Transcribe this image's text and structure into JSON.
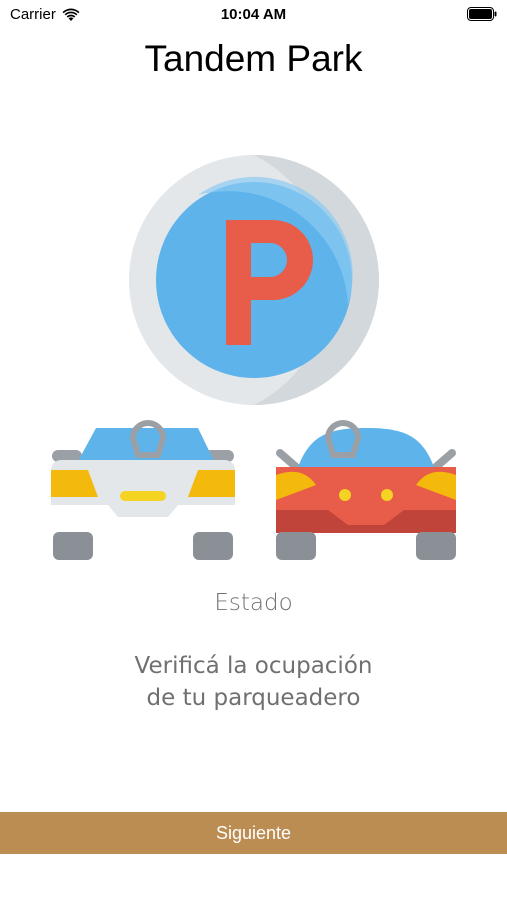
{
  "status_bar": {
    "carrier": "Carrier",
    "time": "10:04 AM",
    "icons": [
      "wifi-icon",
      "battery-icon"
    ]
  },
  "header": {
    "title": "Tandem Park"
  },
  "onboarding": {
    "illustration_icon": "parking-sign-with-two-cars-icon",
    "section_title": "Estado",
    "description_line1": "Verificá la ocupación",
    "description_line2": "de tu parqueadero"
  },
  "footer": {
    "next_label": "Siguiente"
  },
  "colors": {
    "button_background": "#bb8d52",
    "parking_red": "#e85c4a",
    "parking_blue": "#5db3ea"
  }
}
